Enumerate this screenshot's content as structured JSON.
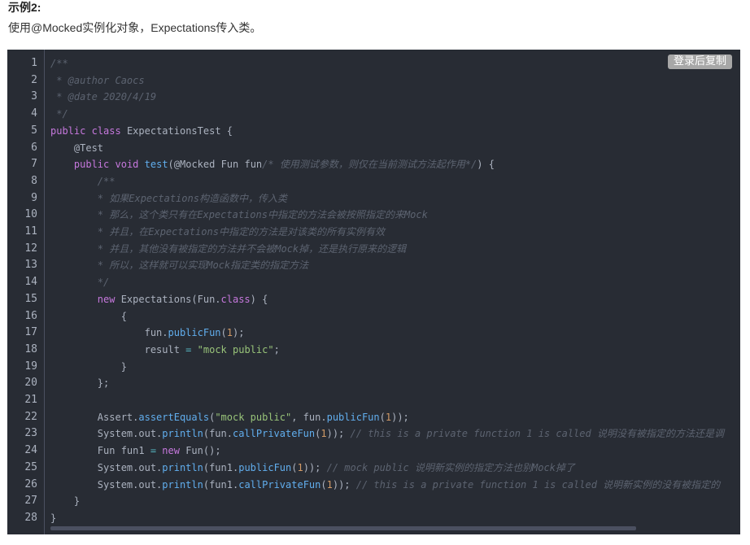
{
  "heading": "示例2:",
  "description": "使用@Mocked实例化对象，Expectations传入类。",
  "copy_button": "登录后复制",
  "colors": {
    "background": "#282c34",
    "plain": "#abb2bf",
    "comment": "#5c6370",
    "keyword": "#c678dd",
    "function": "#61aeee",
    "string": "#98c379",
    "number": "#d19a66",
    "operator": "#56b6c2"
  },
  "code": {
    "lines": [
      [
        [
          "comment",
          "/**"
        ]
      ],
      [
        [
          "comment",
          " * @author Caocs"
        ]
      ],
      [
        [
          "comment",
          " * @date 2020/4/19"
        ]
      ],
      [
        [
          "comment",
          " */"
        ]
      ],
      [
        [
          "keyword",
          "public"
        ],
        [
          "plain",
          " "
        ],
        [
          "keyword",
          "class"
        ],
        [
          "plain",
          " ExpectationsTest {"
        ]
      ],
      [
        [
          "plain",
          "    @Test"
        ]
      ],
      [
        [
          "plain",
          "    "
        ],
        [
          "keyword",
          "public"
        ],
        [
          "plain",
          " "
        ],
        [
          "keyword",
          "void"
        ],
        [
          "plain",
          " "
        ],
        [
          "function",
          "test"
        ],
        [
          "plain",
          "(@Mocked Fun fun"
        ],
        [
          "comment",
          "/* 使用测试参数，则仅在当前测试方法起作用*/"
        ],
        [
          "plain",
          ") {"
        ]
      ],
      [
        [
          "comment",
          "        /**"
        ]
      ],
      [
        [
          "comment",
          "        * 如果Expectations构造函数中，传入类"
        ]
      ],
      [
        [
          "comment",
          "        * 那么，这个类只有在Expectations中指定的方法会被按照指定的来Mock"
        ]
      ],
      [
        [
          "comment",
          "        * 并且，在Expectations中指定的方法是对该类的所有实例有效"
        ]
      ],
      [
        [
          "comment",
          "        * 并且，其他没有被指定的方法并不会被Mock掉，还是执行原来的逻辑"
        ]
      ],
      [
        [
          "comment",
          "        * 所以，这样就可以实现Mock指定类的指定方法"
        ]
      ],
      [
        [
          "comment",
          "        */"
        ]
      ],
      [
        [
          "plain",
          "        "
        ],
        [
          "keyword",
          "new"
        ],
        [
          "plain",
          " Expectations(Fun."
        ],
        [
          "keyword",
          "class"
        ],
        [
          "plain",
          ") {"
        ]
      ],
      [
        [
          "plain",
          "            {"
        ]
      ],
      [
        [
          "plain",
          "                fun."
        ],
        [
          "function",
          "publicFun"
        ],
        [
          "plain",
          "("
        ],
        [
          "number",
          "1"
        ],
        [
          "plain",
          ");"
        ]
      ],
      [
        [
          "plain",
          "                result "
        ],
        [
          "operator",
          "="
        ],
        [
          "plain",
          " "
        ],
        [
          "string",
          "\"mock public\""
        ],
        [
          "plain",
          ";"
        ]
      ],
      [
        [
          "plain",
          "            }"
        ]
      ],
      [
        [
          "plain",
          "        };"
        ]
      ],
      [
        [
          "plain",
          ""
        ]
      ],
      [
        [
          "plain",
          "        Assert."
        ],
        [
          "function",
          "assertEquals"
        ],
        [
          "plain",
          "("
        ],
        [
          "string",
          "\"mock public\""
        ],
        [
          "plain",
          ", fun."
        ],
        [
          "function",
          "publicFun"
        ],
        [
          "plain",
          "("
        ],
        [
          "number",
          "1"
        ],
        [
          "plain",
          "));"
        ]
      ],
      [
        [
          "plain",
          "        System.out."
        ],
        [
          "function",
          "println"
        ],
        [
          "plain",
          "(fun."
        ],
        [
          "function",
          "callPrivateFun"
        ],
        [
          "plain",
          "("
        ],
        [
          "number",
          "1"
        ],
        [
          "plain",
          ")); "
        ],
        [
          "comment",
          "// this is a private function 1 is called 说明没有被指定的方法还是调"
        ]
      ],
      [
        [
          "plain",
          "        Fun fun1 "
        ],
        [
          "operator",
          "="
        ],
        [
          "plain",
          " "
        ],
        [
          "keyword",
          "new"
        ],
        [
          "plain",
          " Fun();"
        ]
      ],
      [
        [
          "plain",
          "        System.out."
        ],
        [
          "function",
          "println"
        ],
        [
          "plain",
          "(fun1."
        ],
        [
          "function",
          "publicFun"
        ],
        [
          "plain",
          "("
        ],
        [
          "number",
          "1"
        ],
        [
          "plain",
          ")); "
        ],
        [
          "comment",
          "// mock public 说明新实例的指定方法也别Mock掉了"
        ]
      ],
      [
        [
          "plain",
          "        System.out."
        ],
        [
          "function",
          "println"
        ],
        [
          "plain",
          "(fun1."
        ],
        [
          "function",
          "callPrivateFun"
        ],
        [
          "plain",
          "("
        ],
        [
          "number",
          "1"
        ],
        [
          "plain",
          ")); "
        ],
        [
          "comment",
          "// this is a private function 1 is called 说明新实例的没有被指定的"
        ]
      ],
      [
        [
          "plain",
          "    }"
        ]
      ],
      [
        [
          "plain",
          "}"
        ]
      ]
    ]
  }
}
